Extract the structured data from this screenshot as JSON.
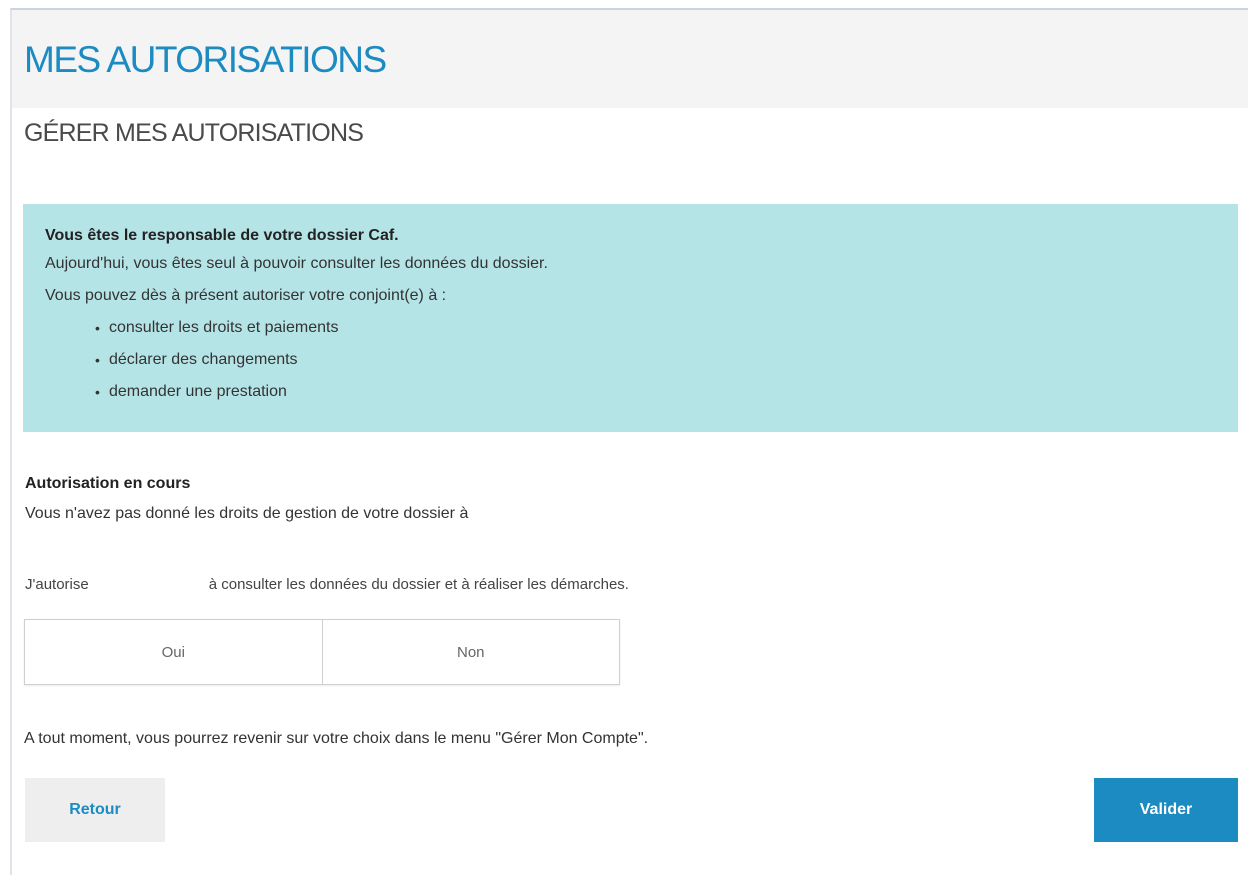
{
  "header": {
    "title": "MES AUTORISATIONS"
  },
  "section": {
    "title": "GÉRER MES AUTORISATIONS"
  },
  "info": {
    "title": "Vous êtes le responsable de votre dossier Caf.",
    "line1": "Aujourd'hui, vous êtes seul à pouvoir consulter les données du dossier.",
    "line2": "Vous pouvez dès à présent autoriser votre conjoint(e) à :",
    "items": [
      "consulter les droits et paiements",
      "déclarer des changements",
      "demander une prestation"
    ]
  },
  "authorization": {
    "heading": "Autorisation en cours",
    "description": "Vous n'avez pas donné les droits de gestion de votre dossier à",
    "authorize_prefix": "J'autorise",
    "authorize_suffix": "à consulter les données du dossier et à réaliser les démarches.",
    "options": [
      "Oui",
      "Non"
    ]
  },
  "notice": "A tout moment, vous pourrez revenir sur votre choix dans le menu \"Gérer Mon Compte\".",
  "actions": {
    "back_label": "Retour",
    "validate_label": "Valider"
  },
  "colors": {
    "accent": "#1b8bc2",
    "info_background": "#b5e4e7"
  }
}
